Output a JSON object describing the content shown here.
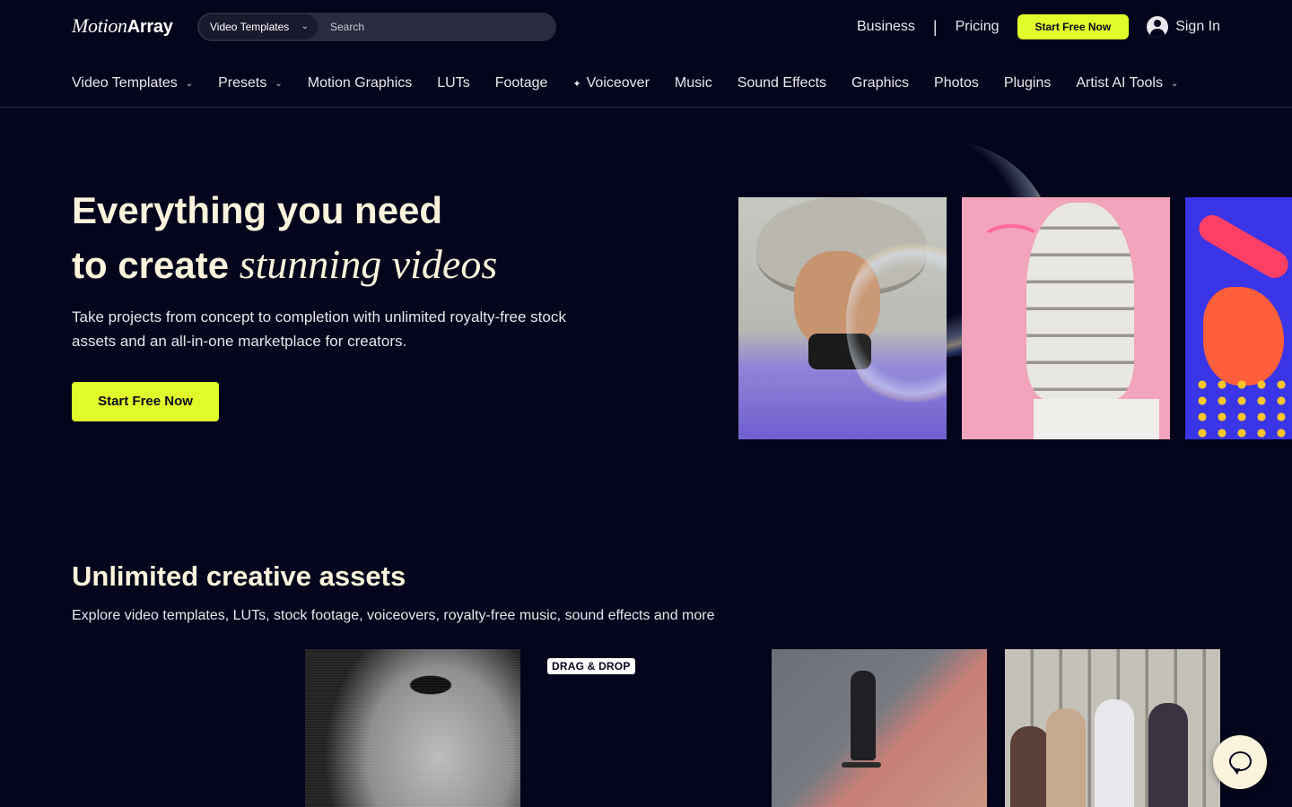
{
  "header": {
    "logo_part1": "Motion",
    "logo_part2": "Array",
    "search": {
      "category": "Video Templates",
      "placeholder": "Search"
    },
    "links": {
      "business": "Business",
      "separator": "|",
      "pricing": "Pricing"
    },
    "cta_label": "Start Free Now",
    "signin_label": "Sign In"
  },
  "nav": {
    "items": [
      {
        "label": "Video Templates",
        "has_dropdown": true
      },
      {
        "label": "Presets",
        "has_dropdown": true
      },
      {
        "label": "Motion Graphics",
        "has_dropdown": false
      },
      {
        "label": "LUTs",
        "has_dropdown": false
      },
      {
        "label": "Footage",
        "has_dropdown": false
      },
      {
        "label": "Voiceover",
        "has_dropdown": false,
        "icon": "sparkle-icon"
      },
      {
        "label": "Music",
        "has_dropdown": false
      },
      {
        "label": "Sound Effects",
        "has_dropdown": false
      },
      {
        "label": "Graphics",
        "has_dropdown": false
      },
      {
        "label": "Photos",
        "has_dropdown": false
      },
      {
        "label": "Plugins",
        "has_dropdown": false
      },
      {
        "label": "Artist AI Tools",
        "has_dropdown": true
      }
    ]
  },
  "hero": {
    "title_line1": "Everything you need",
    "title_line2_prefix": "to create ",
    "title_line2_serif": "stunning videos",
    "subtitle": "Take projects from concept to completion with unlimited royalty-free stock assets and an all-in-one marketplace for creators.",
    "cta_label": "Start Free Now"
  },
  "section": {
    "title": "Unlimited creative assets",
    "subtitle": "Explore video templates, LUTs, stock footage, voiceovers, royalty-free music, sound effects and more",
    "badge": "DRAG & DROP"
  },
  "colors": {
    "background": "#04041c",
    "accent": "#e0fc2a",
    "heading": "#fbf3dc"
  }
}
